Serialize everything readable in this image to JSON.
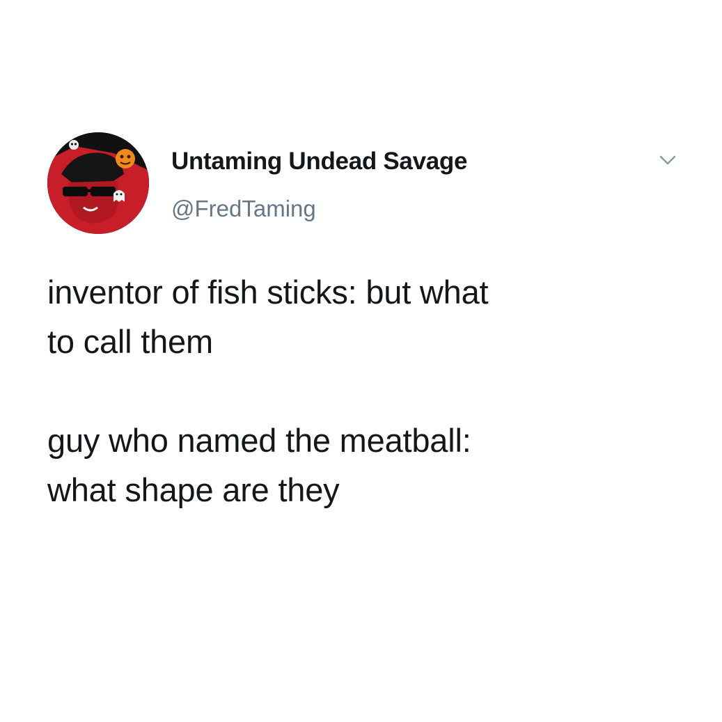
{
  "tweet": {
    "author": {
      "display_name": "Untaming Undead Savage",
      "handle": "@FredTaming",
      "avatar_icon": "profile-avatar"
    },
    "menu_icon": "chevron-down-icon",
    "paragraphs": [
      "inventor of fish sticks: but what\nto call them",
      "guy who named the meatball:\nwhat shape are they"
    ]
  },
  "colors": {
    "text": "#14171a",
    "secondary_text": "#657786",
    "background": "#ffffff",
    "avatar_red": "#c81e2a"
  }
}
